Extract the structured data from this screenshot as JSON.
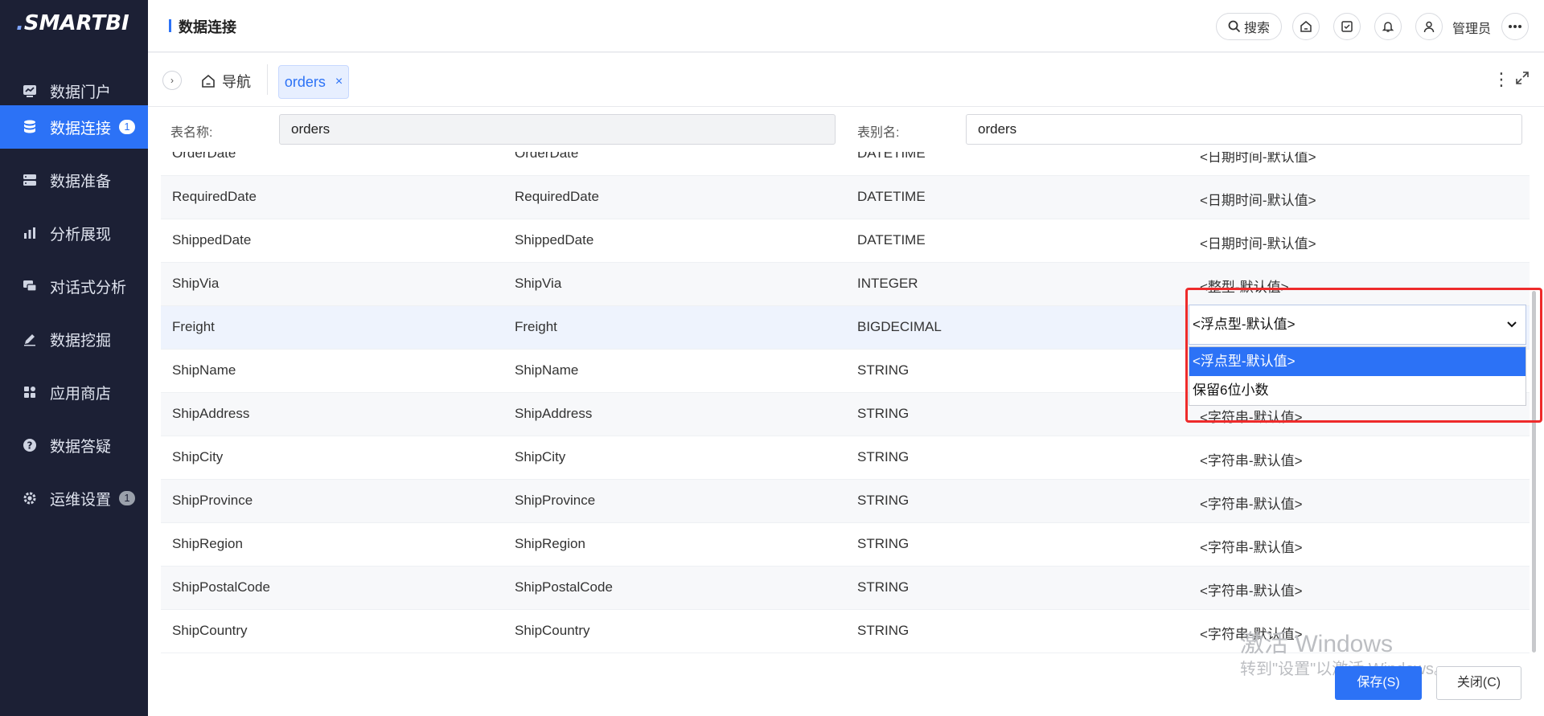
{
  "app": {
    "logo": "SMARTBI"
  },
  "sidebar": {
    "items": [
      {
        "label": "数据门户",
        "icon": "chart-board-icon",
        "badge": ""
      },
      {
        "label": "数据连接",
        "icon": "database-icon",
        "badge": "1",
        "active": true
      },
      {
        "label": "数据准备",
        "icon": "server-icon",
        "badge": ""
      },
      {
        "label": "分析展现",
        "icon": "bar-chart-icon",
        "badge": ""
      },
      {
        "label": "对话式分析",
        "icon": "chat-icon",
        "badge": ""
      },
      {
        "label": "数据挖掘",
        "icon": "pen-icon",
        "badge": ""
      },
      {
        "label": "应用商店",
        "icon": "apps-icon",
        "badge": ""
      },
      {
        "label": "数据答疑",
        "icon": "help-icon",
        "badge": ""
      },
      {
        "label": "运维设置",
        "icon": "gear-icon",
        "badge": "1"
      }
    ]
  },
  "header": {
    "title": "数据连接",
    "search_label": "搜索",
    "user_name": "管理员"
  },
  "tabs": {
    "home_label": "导航",
    "active_label": "orders",
    "close_symbol": "×"
  },
  "form": {
    "table_name_label": "表名称:",
    "table_name_value": "orders",
    "table_alias_label": "表别名:",
    "table_alias_value": "orders"
  },
  "rows": [
    {
      "name": "OrderDate",
      "alias": "OrderDate",
      "type": "DATETIME",
      "format": "<日期时间-默认值>"
    },
    {
      "name": "RequiredDate",
      "alias": "RequiredDate",
      "type": "DATETIME",
      "format": "<日期时间-默认值>"
    },
    {
      "name": "ShippedDate",
      "alias": "ShippedDate",
      "type": "DATETIME",
      "format": "<日期时间-默认值>"
    },
    {
      "name": "ShipVia",
      "alias": "ShipVia",
      "type": "INTEGER",
      "format": "<整型-默认值>"
    },
    {
      "name": "Freight",
      "alias": "Freight",
      "type": "BIGDECIMAL",
      "format": ""
    },
    {
      "name": "ShipName",
      "alias": "ShipName",
      "type": "STRING",
      "format": ""
    },
    {
      "name": "ShipAddress",
      "alias": "ShipAddress",
      "type": "STRING",
      "format": "<字符串-默认值>"
    },
    {
      "name": "ShipCity",
      "alias": "ShipCity",
      "type": "STRING",
      "format": "<字符串-默认值>"
    },
    {
      "name": "ShipProvince",
      "alias": "ShipProvince",
      "type": "STRING",
      "format": "<字符串-默认值>"
    },
    {
      "name": "ShipRegion",
      "alias": "ShipRegion",
      "type": "STRING",
      "format": "<字符串-默认值>"
    },
    {
      "name": "ShipPostalCode",
      "alias": "ShipPostalCode",
      "type": "STRING",
      "format": "<字符串-默认值>"
    },
    {
      "name": "ShipCountry",
      "alias": "ShipCountry",
      "type": "STRING",
      "format": "<字符串-默认值>"
    }
  ],
  "format_select": {
    "value": "<浮点型-默认值>",
    "options": [
      "<浮点型-默认值>",
      "保留6位小数"
    ]
  },
  "watermark": {
    "line1": "激活 Windows",
    "line2": "转到\"设置\"以激活 Windows。"
  },
  "buttons": {
    "save": "保存(S)",
    "close": "关闭(C)"
  },
  "colors": {
    "sidebar_bg": "#1c2035",
    "accent": "#2c72f6",
    "highlight_border": "#ee2b2b"
  }
}
